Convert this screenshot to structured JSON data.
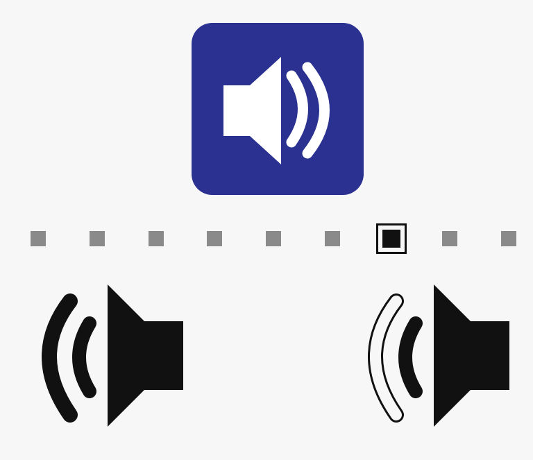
{
  "icons": {
    "main": "speaker-volume-icon",
    "decrease": "volume-decrease-icon",
    "increase": "volume-increase-icon"
  },
  "colors": {
    "main_bg": "#2b3191",
    "main_glyph": "#ffffff",
    "step_inactive": "#8a8a8a",
    "step_active": "#111111",
    "side_glyph": "#111111"
  },
  "volume": {
    "steps_total": 9,
    "current_step": 7
  }
}
